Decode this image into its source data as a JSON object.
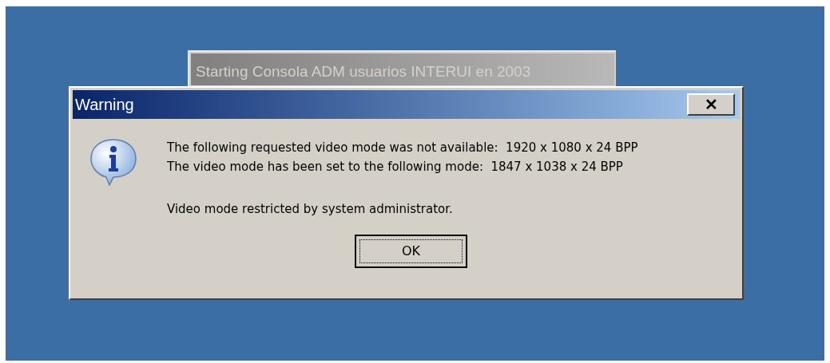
{
  "background_window": {
    "title": "Starting Consola ADM usuarios INTERUI en 2003"
  },
  "dialog": {
    "title": "Warning",
    "close_label": "✕",
    "message_lines": [
      "The following requested video mode was not available:  1920 x 1080 x 24 BPP",
      "The video mode has been set to the following mode:  1847 x 1038 x 24 BPP"
    ],
    "note": "Video mode restricted by system administrator.",
    "buttons": [
      {
        "label": "OK",
        "focused": true
      }
    ]
  }
}
